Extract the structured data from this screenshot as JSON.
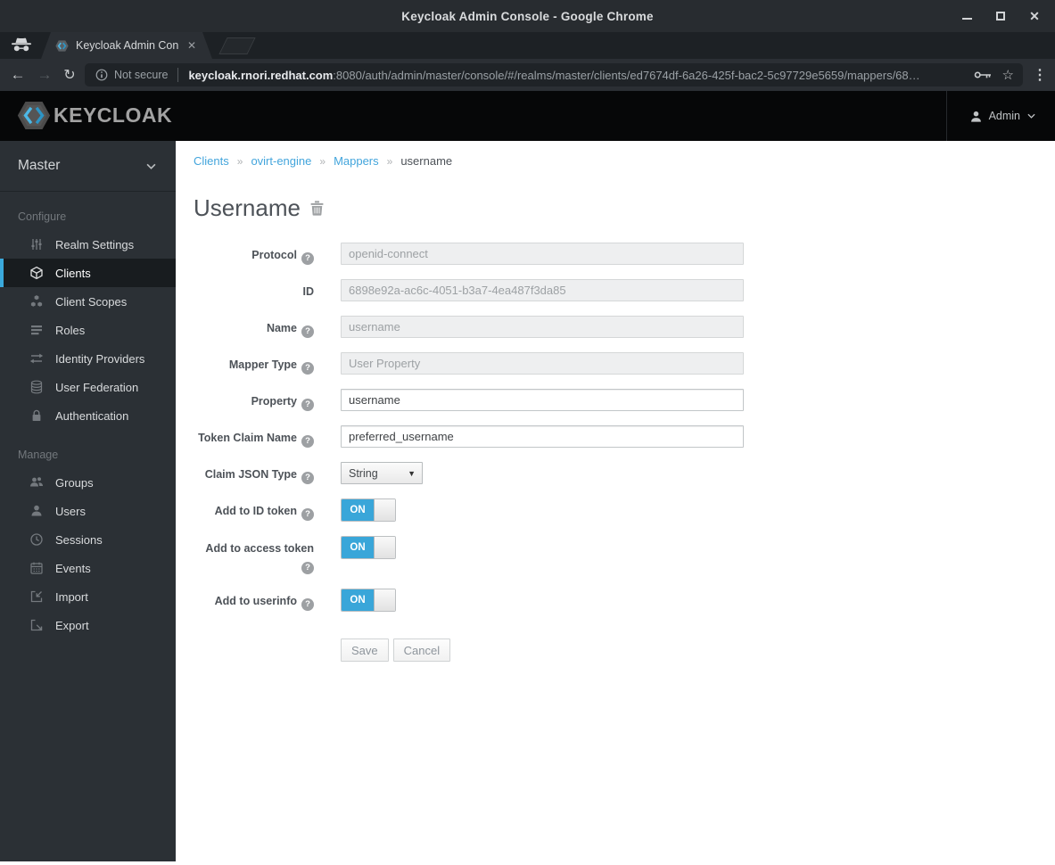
{
  "ui": {
    "help_glyph": "?",
    "breadcrumb_separator": "»"
  },
  "window": {
    "title": "Keycloak Admin Console - Google Chrome",
    "close_glyph": "✕"
  },
  "browser": {
    "tab": {
      "title": "Keycloak Admin Con",
      "close_glyph": "✕"
    },
    "toolbar": {
      "back_glyph": "←",
      "forward_glyph": "→",
      "reload_glyph": "↻",
      "star_glyph": "☆",
      "menu_glyph": "⋮"
    },
    "omnibox": {
      "security_label": "Not secure",
      "domain": "keycloak.rnori.redhat.com",
      "path": ":8080/auth/admin/master/console/#/realms/master/clients/ed7674df-6a26-425f-bac2-5c97729e5659/mappers/68…"
    }
  },
  "header": {
    "brand": "KEYCLOAK",
    "user_label": "Admin"
  },
  "sidebar": {
    "realm_label": "Master",
    "sections": [
      {
        "label": "Configure",
        "items": [
          {
            "label": "Realm Settings",
            "icon": "sliders-icon"
          },
          {
            "label": "Clients",
            "icon": "cube-icon"
          },
          {
            "label": "Client Scopes",
            "icon": "cubes-icon"
          },
          {
            "label": "Roles",
            "icon": "list-icon"
          },
          {
            "label": "Identity Providers",
            "icon": "exchange-icon"
          },
          {
            "label": "User Federation",
            "icon": "database-icon"
          },
          {
            "label": "Authentication",
            "icon": "lock-icon"
          }
        ]
      },
      {
        "label": "Manage",
        "items": [
          {
            "label": "Groups",
            "icon": "group-icon"
          },
          {
            "label": "Users",
            "icon": "user-icon"
          },
          {
            "label": "Sessions",
            "icon": "clock-icon"
          },
          {
            "label": "Events",
            "icon": "calendar-icon"
          },
          {
            "label": "Import",
            "icon": "import-icon"
          },
          {
            "label": "Export",
            "icon": "export-icon"
          }
        ]
      }
    ]
  },
  "main": {
    "breadcrumb": [
      {
        "label": "Clients"
      },
      {
        "label": "ovirt-engine"
      },
      {
        "label": "Mappers"
      },
      {
        "label": "username"
      }
    ],
    "title": "Username",
    "form": {
      "fields": [
        {
          "label": "Protocol",
          "help": true,
          "control": "input",
          "value": "openid-connect",
          "disabled": true
        },
        {
          "label": "ID",
          "help": false,
          "control": "input",
          "value": "6898e92a-ac6c-4051-b3a7-4ea487f3da85",
          "disabled": true
        },
        {
          "label": "Name",
          "help": true,
          "control": "input",
          "value": "username",
          "disabled": true
        },
        {
          "label": "Mapper Type",
          "help": true,
          "control": "input",
          "value": "User Property",
          "disabled": true
        },
        {
          "label": "Property",
          "help": true,
          "control": "input",
          "value": "username",
          "disabled": false
        },
        {
          "label": "Token Claim Name",
          "help": true,
          "control": "input",
          "value": "preferred_username",
          "disabled": false
        },
        {
          "label": "Claim JSON Type",
          "help": true,
          "control": "select",
          "value": "String"
        },
        {
          "label": "Add to ID token",
          "help": true,
          "control": "toggle",
          "value": "ON"
        },
        {
          "label": "Add to access token",
          "help": true,
          "control": "toggle",
          "value": "ON"
        },
        {
          "label": "Add to userinfo",
          "help": true,
          "control": "toggle",
          "value": "ON"
        }
      ],
      "save_label": "Save",
      "cancel_label": "Cancel"
    }
  },
  "colors": {
    "accent": "#3aa9dc",
    "link": "#43a5dc",
    "toggle_on": "#39a6d9",
    "header_bg": "#060708",
    "sidebar_bg": "#2b3035"
  }
}
